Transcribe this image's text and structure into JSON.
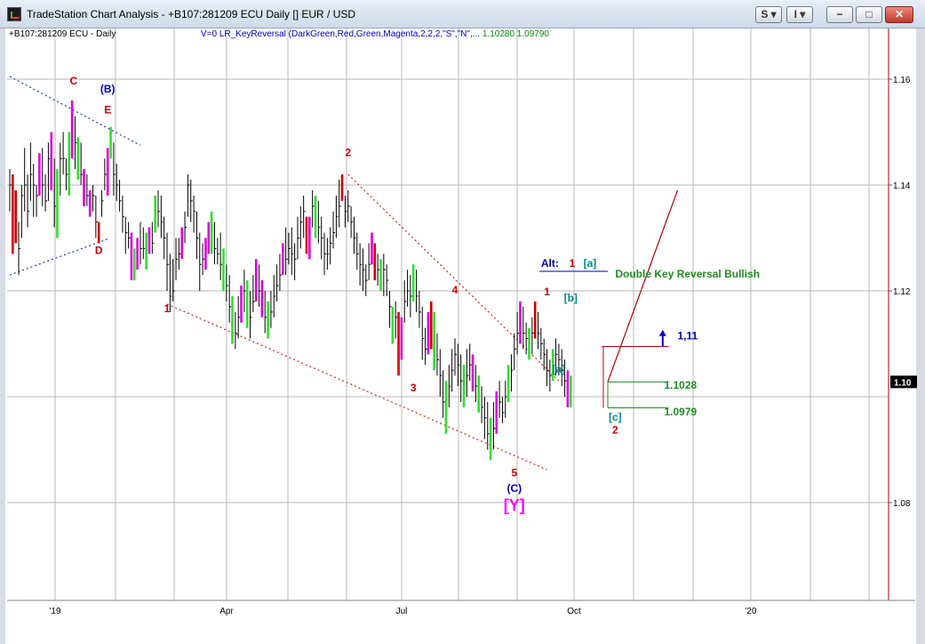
{
  "window": {
    "title": "TradeStation Chart Analysis - +B107:281209 ECU Daily [] EUR / USD",
    "buttons": [
      {
        "name": "s-menu-button",
        "label": "S ▾"
      },
      {
        "name": "i-menu-button",
        "label": "I ▾"
      },
      {
        "name": "minimize-button",
        "label": "−"
      },
      {
        "name": "maximize-button",
        "label": "□"
      },
      {
        "name": "close-button",
        "label": "✕"
      }
    ]
  },
  "chart_header": {
    "symbol": "+B107:281209 ECU - Daily",
    "indicator": "V=0  LR_KeyReversal (DarkGreen,Red,Green,Magenta,2,2,2,\"S\",\"N\",...",
    "value1": "1.10280",
    "value2": "1.09790"
  },
  "chart_data": {
    "type": "candlestick",
    "x_tick_labels": [
      "'19",
      "Apr",
      "Jul",
      "Oct",
      "'20"
    ],
    "y_tick_labels": [
      "1.16",
      "1.14",
      "1.12",
      "1.08"
    ],
    "ylim": [
      1.06304,
      1.16755
    ],
    "current_price_label": "1.10",
    "grid": true,
    "colors": {
      "default": "#000000",
      "dark_green": "#006400",
      "red": "#d00000",
      "green": "#33dd33",
      "magenta": "#dd00dd"
    },
    "bars": [
      [
        1.143,
        1.135,
        1.14,
        "d"
      ],
      [
        1.142,
        1.127,
        1.135,
        "r"
      ],
      [
        1.139,
        1.129,
        1.135,
        "r"
      ],
      [
        1.133,
        1.123,
        1.128,
        "d"
      ],
      [
        1.14,
        1.13,
        1.138,
        "d"
      ],
      [
        1.147,
        1.135,
        1.14,
        "d"
      ],
      [
        1.142,
        1.132,
        1.135,
        "d"
      ],
      [
        1.148,
        1.137,
        1.142,
        "d"
      ],
      [
        1.144,
        1.134,
        1.14,
        "d"
      ],
      [
        1.14,
        1.134,
        1.138,
        "d"
      ],
      [
        1.146,
        1.138,
        1.145,
        "m"
      ],
      [
        1.147,
        1.136,
        1.14,
        "d"
      ],
      [
        1.142,
        1.135,
        1.137,
        "d"
      ],
      [
        1.148,
        1.137,
        1.145,
        "d"
      ],
      [
        1.15,
        1.139,
        1.148,
        "m"
      ],
      [
        1.145,
        1.132,
        1.136,
        "d"
      ],
      [
        1.143,
        1.13,
        1.132,
        "g"
      ],
      [
        1.148,
        1.138,
        1.145,
        "d"
      ],
      [
        1.15,
        1.142,
        1.145,
        "d"
      ],
      [
        1.145,
        1.139,
        1.142,
        "d"
      ],
      [
        1.15,
        1.138,
        1.145,
        "g"
      ],
      [
        1.156,
        1.145,
        1.154,
        "m"
      ],
      [
        1.153,
        1.143,
        1.148,
        "d"
      ],
      [
        1.149,
        1.141,
        1.145,
        "g"
      ],
      [
        1.148,
        1.14,
        1.142,
        "d"
      ],
      [
        1.143,
        1.136,
        1.138,
        "m"
      ],
      [
        1.142,
        1.136,
        1.138,
        "d"
      ],
      [
        1.139,
        1.134,
        1.136,
        "m"
      ],
      [
        1.14,
        1.135,
        1.138,
        "d"
      ],
      [
        1.138,
        1.13,
        1.133,
        "d"
      ],
      [
        1.133,
        1.129,
        1.13,
        "r"
      ],
      [
        1.139,
        1.134,
        1.137,
        "d"
      ],
      [
        1.145,
        1.139,
        1.142,
        "d"
      ],
      [
        1.147,
        1.138,
        1.143,
        "m"
      ],
      [
        1.151,
        1.145,
        1.148,
        "g"
      ],
      [
        1.148,
        1.138,
        1.142,
        "d"
      ],
      [
        1.144,
        1.137,
        1.14,
        "d"
      ],
      [
        1.141,
        1.135,
        1.137,
        "d"
      ],
      [
        1.138,
        1.131,
        1.134,
        "d"
      ],
      [
        1.134,
        1.127,
        1.131,
        "d"
      ],
      [
        1.133,
        1.128,
        1.13,
        "d"
      ],
      [
        1.131,
        1.122,
        1.126,
        "m"
      ],
      [
        1.128,
        1.122,
        1.124,
        "g"
      ],
      [
        1.13,
        1.124,
        1.127,
        "m"
      ],
      [
        1.133,
        1.125,
        1.128,
        "d"
      ],
      [
        1.132,
        1.126,
        1.128,
        "d"
      ],
      [
        1.131,
        1.124,
        1.127,
        "g"
      ],
      [
        1.132,
        1.127,
        1.13,
        "m"
      ],
      [
        1.133,
        1.127,
        1.129,
        "d"
      ],
      [
        1.138,
        1.131,
        1.134,
        "g"
      ],
      [
        1.139,
        1.132,
        1.135,
        "d"
      ],
      [
        1.138,
        1.13,
        1.133,
        "d"
      ],
      [
        1.134,
        1.126,
        1.13,
        "d"
      ],
      [
        1.131,
        1.12,
        1.125,
        "d"
      ],
      [
        1.127,
        1.116,
        1.119,
        "d"
      ],
      [
        1.126,
        1.118,
        1.12,
        "d"
      ],
      [
        1.13,
        1.122,
        1.126,
        "d"
      ],
      [
        1.13,
        1.124,
        1.127,
        "d"
      ],
      [
        1.132,
        1.126,
        1.128,
        "m"
      ],
      [
        1.135,
        1.129,
        1.132,
        "d"
      ],
      [
        1.142,
        1.134,
        1.14,
        "d"
      ],
      [
        1.141,
        1.133,
        1.137,
        "d"
      ],
      [
        1.138,
        1.131,
        1.135,
        "d"
      ],
      [
        1.135,
        1.126,
        1.13,
        "d"
      ],
      [
        1.131,
        1.12,
        1.125,
        "d"
      ],
      [
        1.129,
        1.123,
        1.126,
        "d"
      ],
      [
        1.13,
        1.124,
        1.128,
        "m"
      ],
      [
        1.133,
        1.127,
        1.13,
        "m"
      ],
      [
        1.135,
        1.127,
        1.129,
        "g"
      ],
      [
        1.133,
        1.125,
        1.128,
        "d"
      ],
      [
        1.13,
        1.125,
        1.127,
        "d"
      ],
      [
        1.131,
        1.122,
        1.125,
        "d"
      ],
      [
        1.128,
        1.12,
        1.123,
        "g"
      ],
      [
        1.125,
        1.118,
        1.121,
        "d"
      ],
      [
        1.123,
        1.114,
        1.117,
        "d"
      ],
      [
        1.119,
        1.11,
        1.113,
        "g"
      ],
      [
        1.116,
        1.109,
        1.112,
        "d"
      ],
      [
        1.119,
        1.111,
        1.115,
        "d"
      ],
      [
        1.121,
        1.114,
        1.118,
        "m"
      ],
      [
        1.124,
        1.116,
        1.12,
        "d"
      ],
      [
        1.122,
        1.113,
        1.117,
        "g"
      ],
      [
        1.12,
        1.111,
        1.115,
        "d"
      ],
      [
        1.123,
        1.116,
        1.118,
        "d"
      ],
      [
        1.126,
        1.118,
        1.121,
        "m"
      ],
      [
        1.125,
        1.117,
        1.12,
        "d"
      ],
      [
        1.122,
        1.115,
        1.118,
        "m"
      ],
      [
        1.12,
        1.112,
        1.115,
        "d"
      ],
      [
        1.118,
        1.111,
        1.114,
        "g"
      ],
      [
        1.12,
        1.113,
        1.116,
        "d"
      ],
      [
        1.123,
        1.115,
        1.119,
        "d"
      ],
      [
        1.125,
        1.118,
        1.121,
        "d"
      ],
      [
        1.127,
        1.12,
        1.123,
        "d"
      ],
      [
        1.129,
        1.123,
        1.126,
        "m"
      ],
      [
        1.132,
        1.123,
        1.126,
        "d"
      ],
      [
        1.131,
        1.125,
        1.128,
        "d"
      ],
      [
        1.132,
        1.123,
        1.127,
        "d"
      ],
      [
        1.129,
        1.122,
        1.126,
        "d"
      ],
      [
        1.134,
        1.126,
        1.13,
        "d"
      ],
      [
        1.136,
        1.128,
        1.133,
        "d"
      ],
      [
        1.138,
        1.13,
        1.135,
        "d"
      ],
      [
        1.134,
        1.127,
        1.13,
        "r"
      ],
      [
        1.134,
        1.126,
        1.13,
        "m"
      ],
      [
        1.139,
        1.132,
        1.136,
        "d"
      ],
      [
        1.138,
        1.13,
        1.133,
        "g"
      ],
      [
        1.137,
        1.129,
        1.132,
        "d"
      ],
      [
        1.134,
        1.126,
        1.13,
        "d"
      ],
      [
        1.131,
        1.123,
        1.127,
        "d"
      ],
      [
        1.13,
        1.124,
        1.127,
        "d"
      ],
      [
        1.132,
        1.125,
        1.129,
        "d"
      ],
      [
        1.135,
        1.128,
        1.131,
        "d"
      ],
      [
        1.138,
        1.13,
        1.134,
        "d"
      ],
      [
        1.141,
        1.132,
        1.136,
        "d"
      ],
      [
        1.142,
        1.137,
        1.139,
        "r"
      ],
      [
        1.138,
        1.132,
        1.135,
        "d"
      ],
      [
        1.139,
        1.133,
        1.136,
        "d"
      ],
      [
        1.136,
        1.13,
        1.133,
        "d"
      ],
      [
        1.134,
        1.127,
        1.13,
        "d"
      ],
      [
        1.131,
        1.124,
        1.127,
        "d"
      ],
      [
        1.129,
        1.121,
        1.125,
        "d"
      ],
      [
        1.128,
        1.12,
        1.124,
        "d"
      ],
      [
        1.125,
        1.119,
        1.122,
        "d"
      ],
      [
        1.129,
        1.122,
        1.125,
        "d"
      ],
      [
        1.131,
        1.125,
        1.128,
        "m"
      ],
      [
        1.129,
        1.122,
        1.126,
        "r"
      ],
      [
        1.127,
        1.121,
        1.124,
        "d"
      ],
      [
        1.126,
        1.12,
        1.122,
        "g"
      ],
      [
        1.127,
        1.119,
        1.124,
        "d"
      ],
      [
        1.125,
        1.119,
        1.122,
        "d"
      ],
      [
        1.12,
        1.113,
        1.117,
        "d"
      ],
      [
        1.117,
        1.11,
        1.113,
        "g"
      ],
      [
        1.118,
        1.111,
        1.115,
        "d"
      ],
      [
        1.116,
        1.104,
        1.108,
        "r"
      ],
      [
        1.115,
        1.107,
        1.111,
        "m"
      ],
      [
        1.122,
        1.114,
        1.118,
        "d"
      ],
      [
        1.124,
        1.117,
        1.12,
        "d"
      ],
      [
        1.123,
        1.115,
        1.119,
        "d"
      ],
      [
        1.125,
        1.118,
        1.121,
        "g"
      ],
      [
        1.124,
        1.116,
        1.119,
        "d"
      ],
      [
        1.12,
        1.113,
        1.116,
        "d"
      ],
      [
        1.117,
        1.107,
        1.111,
        "d"
      ],
      [
        1.113,
        1.106,
        1.109,
        "d"
      ],
      [
        1.116,
        1.108,
        1.112,
        "m"
      ],
      [
        1.118,
        1.109,
        1.113,
        "r"
      ],
      [
        1.116,
        1.105,
        1.108,
        "g"
      ],
      [
        1.112,
        1.104,
        1.107,
        "d"
      ],
      [
        1.109,
        1.1,
        1.104,
        "d"
      ],
      [
        1.105,
        1.096,
        1.099,
        "d"
      ],
      [
        1.103,
        1.093,
        1.096,
        "g"
      ],
      [
        1.106,
        1.098,
        1.102,
        "d"
      ],
      [
        1.109,
        1.101,
        1.105,
        "d"
      ],
      [
        1.111,
        1.104,
        1.108,
        "d"
      ],
      [
        1.11,
        1.102,
        1.106,
        "d"
      ],
      [
        1.108,
        1.099,
        1.103,
        "d"
      ],
      [
        1.106,
        1.098,
        1.101,
        "g"
      ],
      [
        1.109,
        1.1,
        1.104,
        "d"
      ],
      [
        1.11,
        1.103,
        1.106,
        "d"
      ],
      [
        1.108,
        1.101,
        1.104,
        "m"
      ],
      [
        1.106,
        1.099,
        1.102,
        "d"
      ],
      [
        1.104,
        1.097,
        1.1,
        "g"
      ],
      [
        1.102,
        1.095,
        1.098,
        "d"
      ],
      [
        1.1,
        1.092,
        1.096,
        "d"
      ],
      [
        1.099,
        1.09,
        1.093,
        "d"
      ],
      [
        1.096,
        1.088,
        1.091,
        "g"
      ],
      [
        1.099,
        1.09,
        1.094,
        "d"
      ],
      [
        1.101,
        1.093,
        1.097,
        "m"
      ],
      [
        1.103,
        1.096,
        1.099,
        "d"
      ],
      [
        1.1,
        1.095,
        1.097,
        "d"
      ],
      [
        1.103,
        1.096,
        1.1,
        "d"
      ],
      [
        1.106,
        1.099,
        1.102,
        "g"
      ],
      [
        1.108,
        1.101,
        1.105,
        "d"
      ],
      [
        1.112,
        1.105,
        1.109,
        "d"
      ],
      [
        1.116,
        1.108,
        1.112,
        "d"
      ],
      [
        1.118,
        1.11,
        1.115,
        "m"
      ],
      [
        1.117,
        1.109,
        1.112,
        "d"
      ],
      [
        1.114,
        1.108,
        1.111,
        "d"
      ],
      [
        1.113,
        1.107,
        1.11,
        "g"
      ],
      [
        1.115,
        1.108,
        1.112,
        "d"
      ],
      [
        1.118,
        1.111,
        1.115,
        "r"
      ],
      [
        1.116,
        1.109,
        1.112,
        "d"
      ],
      [
        1.113,
        1.107,
        1.11,
        "d"
      ],
      [
        1.111,
        1.105,
        1.108,
        "d"
      ],
      [
        1.109,
        1.102,
        1.105,
        "d"
      ],
      [
        1.107,
        1.101,
        1.104,
        "d"
      ],
      [
        1.109,
        1.103,
        1.106,
        "g"
      ],
      [
        1.111,
        1.104,
        1.108,
        "d"
      ],
      [
        1.11,
        1.104,
        1.107,
        "d"
      ],
      [
        1.109,
        1.102,
        1.105,
        "d"
      ],
      [
        1.107,
        1.1,
        1.103,
        "d"
      ],
      [
        1.105,
        1.098,
        1.101,
        "m"
      ],
      [
        1.104,
        1.098,
        1.102,
        "g"
      ]
    ],
    "trend_lines": [
      {
        "x1": 0.0,
        "y1": 1.1605,
        "x2": 44.0,
        "y2": 1.1475,
        "color": "#2233cc"
      },
      {
        "x1": 0.0,
        "y1": 1.123,
        "x2": 33.0,
        "y2": 1.1298,
        "color": "#2233cc"
      },
      {
        "x1": 53.0,
        "y1": 1.1175,
        "x2": 181.0,
        "y2": 1.0862,
        "color": "#d02020"
      },
      {
        "x1": 114.0,
        "y1": 1.142,
        "x2": 185.0,
        "y2": 1.103,
        "color": "#d02020"
      }
    ],
    "projection_line": {
      "x1": 201.5,
      "y1": 1.1028,
      "x2": 225.0,
      "y2": 1.139,
      "color": "#b00000"
    },
    "alt_underline": {
      "x1": 178.5,
      "y1": 1.1237,
      "x2": 201.5,
      "y2": 1.1237,
      "color": "#0000aa"
    },
    "reversal_box": {
      "x1": 200.0,
      "x2": 222.0,
      "red_level": 1.1095,
      "high_level": 1.1028,
      "low_level": 1.0979
    },
    "annotations": [
      {
        "text": "C",
        "x": 21.5,
        "y": 1.159,
        "color": "#cc0000"
      },
      {
        "text": "(B)",
        "x": 33.0,
        "y": 1.1575,
        "color": "#0000bb"
      },
      {
        "text": "E",
        "x": 33.0,
        "y": 1.1535,
        "color": "#cc0000"
      },
      {
        "text": "D",
        "x": 30.0,
        "y": 1.127,
        "color": "#cc0000"
      },
      {
        "text": "2",
        "x": 114.0,
        "y": 1.1455,
        "color": "#cc0000"
      },
      {
        "text": "1",
        "x": 53.0,
        "y": 1.116,
        "color": "#cc0000"
      },
      {
        "text": "3",
        "x": 136.0,
        "y": 1.101,
        "color": "#cc0000"
      },
      {
        "text": "4",
        "x": 150.0,
        "y": 1.1195,
        "color": "#cc0000"
      },
      {
        "text": "5",
        "x": 170.0,
        "y": 1.085,
        "color": "#cc0000"
      },
      {
        "text": "(C)",
        "x": 170.0,
        "y": 1.082,
        "color": "#0000bb"
      },
      {
        "text": "[Y]",
        "x": 170.0,
        "y": 1.0785,
        "color": "#ff00ff"
      },
      {
        "text": "1",
        "x": 181.0,
        "y": 1.1192,
        "color": "#cc0000"
      },
      {
        "text": "[b]",
        "x": 189.0,
        "y": 1.118,
        "color": "#008b8b"
      },
      {
        "text": "[a]",
        "x": 185.0,
        "y": 1.1045,
        "color": "#008b8b"
      },
      {
        "text": "[c]",
        "x": 204.0,
        "y": 1.0955,
        "color": "#008b8b"
      },
      {
        "text": "2",
        "x": 204.0,
        "y": 1.093,
        "color": "#cc0000"
      },
      {
        "text": "Alt:",
        "x": 182.0,
        "y": 1.1245,
        "color": "#0000aa"
      },
      {
        "text": "1",
        "x": 189.5,
        "y": 1.1245,
        "color": "#cc0000"
      },
      {
        "text": "[a]",
        "x": 195.5,
        "y": 1.1245,
        "color": "#008b8b"
      },
      {
        "text": "Double Key Reversal Bullish",
        "x": 204.0,
        "y": 1.1225,
        "color": "#228b22"
      },
      {
        "text": "1,11",
        "x": 225.0,
        "y": 1.1108,
        "color": "#0000bb"
      },
      {
        "text": "1.1028",
        "x": 220.5,
        "y": 1.1015,
        "color": "#228b22"
      },
      {
        "text": "1.0979",
        "x": 220.5,
        "y": 1.0965,
        "color": "#228b22"
      }
    ]
  }
}
